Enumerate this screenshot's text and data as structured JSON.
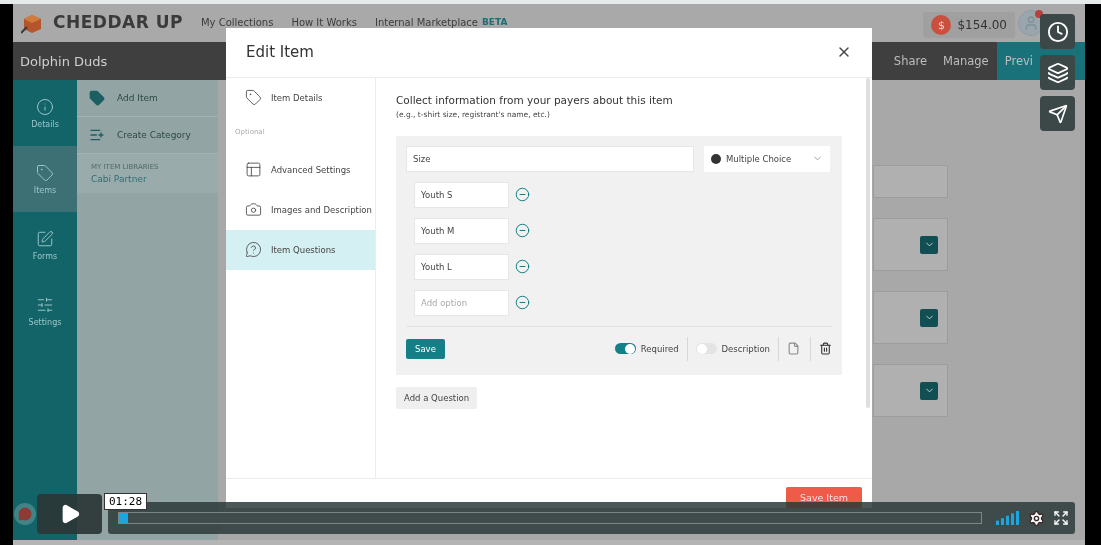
{
  "app": {
    "brand": "CHEDDAR UP",
    "nav": [
      "My Collections",
      "How It Works",
      "Internal Marketplace"
    ],
    "nav_badge": "BETA",
    "balance_symbol": "$",
    "balance": "$154.00",
    "collection_title": "Dolphin Duds",
    "top_tabs": [
      {
        "label": "Share",
        "selected": false
      },
      {
        "label": "Manage",
        "selected": false
      },
      {
        "label": "Previ",
        "selected": true
      }
    ],
    "sidebar": [
      {
        "label": "Details",
        "selected": false
      },
      {
        "label": "Items",
        "selected": true
      },
      {
        "label": "Forms",
        "selected": false
      },
      {
        "label": "Settings",
        "selected": false
      }
    ],
    "panel": {
      "actions": [
        "Add Item",
        "Create Category"
      ],
      "libraries_heading": "MY ITEM LIBRARIES",
      "libraries": [
        "Cabi Partner"
      ]
    }
  },
  "modal": {
    "title": "Edit Item",
    "nav": [
      {
        "kind": "item",
        "label": "Item Details",
        "selected": false
      },
      {
        "kind": "heading",
        "label": "Optional"
      },
      {
        "kind": "item",
        "label": "Advanced Settings",
        "selected": false
      },
      {
        "kind": "item",
        "label": "Images and Description",
        "selected": false
      },
      {
        "kind": "item",
        "label": "Item Questions",
        "selected": true
      }
    ],
    "intro": "Collect information from your payers about this item",
    "hint": "(e.g., t-shirt size, registrant's name, etc.)",
    "question": {
      "value": "Size",
      "type": "Multiple Choice",
      "options": [
        "Youth S",
        "Youth M",
        "Youth L"
      ],
      "new_option_placeholder": "Add option",
      "save": "Save",
      "toggles": [
        {
          "label": "Required",
          "on": true
        },
        {
          "label": "Description",
          "on": false
        }
      ]
    },
    "add_question": "Add a Question",
    "save_item": "Save Item"
  },
  "player": {
    "time": "01:28",
    "level": 0.01
  }
}
